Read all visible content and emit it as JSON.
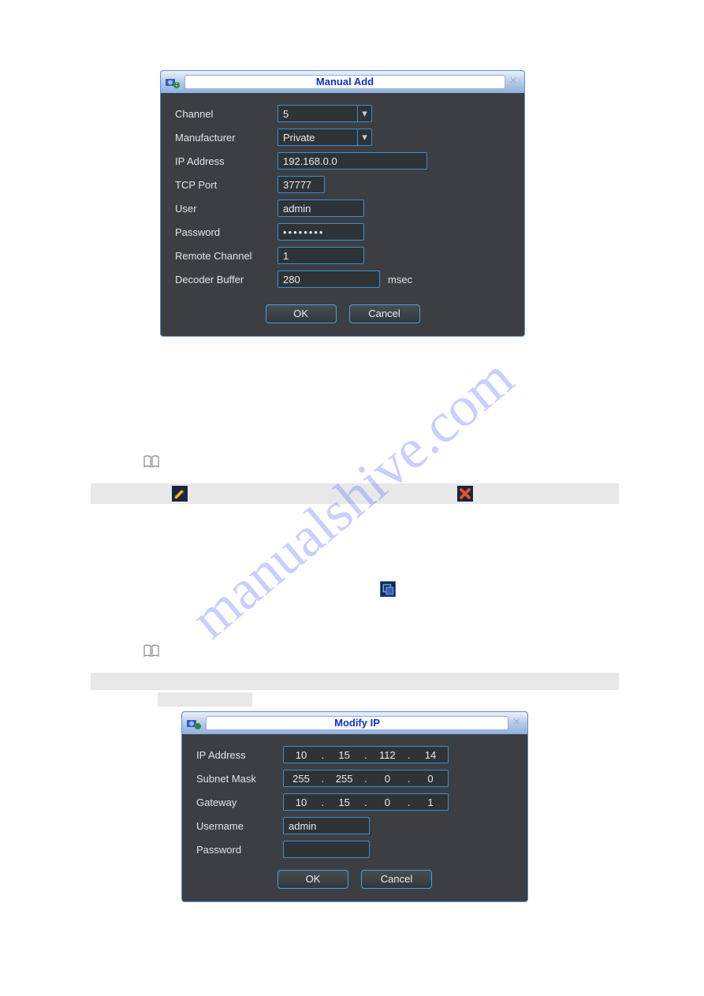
{
  "watermark": "manualshive.com",
  "dialog1": {
    "title": "Manual Add",
    "labels": {
      "channel": "Channel",
      "manufacturer": "Manufacturer",
      "ip": "IP Address",
      "tcp": "TCP Port",
      "user": "User",
      "password": "Password",
      "remote": "Remote Channel",
      "decoder": "Decoder Buffer"
    },
    "values": {
      "channel": "5",
      "manufacturer": "Private",
      "ip": "192.168.0.0",
      "tcp": "37777",
      "user": "admin",
      "password": "••••••••",
      "remote": "1",
      "decoder": "280",
      "decoder_suffix": "msec"
    },
    "buttons": {
      "ok": "OK",
      "cancel": "Cancel"
    }
  },
  "dialog2": {
    "title": "Modify IP",
    "labels": {
      "ip": "IP Address",
      "mask": "Subnet Mask",
      "gateway": "Gateway",
      "username": "Username",
      "password": "Password"
    },
    "values": {
      "ip": [
        "10",
        "15",
        "112",
        "14"
      ],
      "mask": [
        "255",
        "255",
        "0",
        "0"
      ],
      "gateway": [
        "10",
        "15",
        "0",
        "1"
      ],
      "username": "admin",
      "password": ""
    },
    "buttons": {
      "ok": "OK",
      "cancel": "Cancel"
    }
  }
}
